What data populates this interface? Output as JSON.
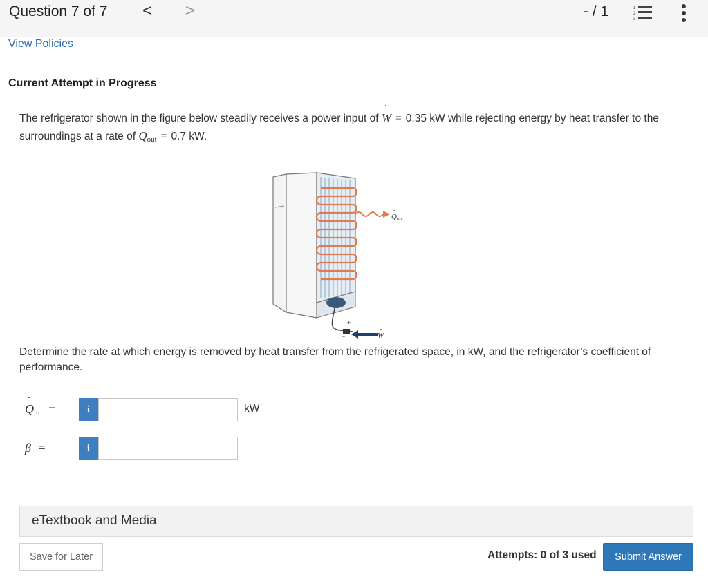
{
  "header": {
    "question_label": "Question 7 of 7",
    "prev": "<",
    "next": ">",
    "score": "- / 1"
  },
  "links": {
    "view_policies": "View Policies"
  },
  "attempt_heading": "Current Attempt in Progress",
  "problem": {
    "text1": "The refrigerator shown in the figure below steadily receives a power input of",
    "w_symbol": "W",
    "eq": "=",
    "w_value": "0.35 kW",
    "text2": "while rejecting energy by heat transfer to the surroundings at a rate of",
    "q_symbol": "Q",
    "q_sub": "out",
    "q_value": "0.7 kW."
  },
  "figure": {
    "q_label": "Q",
    "q_sub": "out",
    "w_label": "W",
    "plus": "+",
    "minus": "−"
  },
  "question": "Determine the rate at which energy is removed by heat transfer from the refrigerated space, in kW, and the refrigerator’s coefficient of performance.",
  "answers": {
    "q_in": {
      "symbol": "Q",
      "sub": "in",
      "eq": "=",
      "info": "i",
      "value": "",
      "unit": "kW"
    },
    "beta": {
      "symbol": "β",
      "eq": "=",
      "info": "i",
      "value": ""
    }
  },
  "etextbook": "eTextbook and Media",
  "footer": {
    "save_label": "Save for Later",
    "attempts": "Attempts: 0 of 3 used",
    "submit_label": "Submit Answer"
  },
  "colors": {
    "accent": "#2f78b8",
    "link": "#2a6db5",
    "coil": "#e07b50"
  }
}
